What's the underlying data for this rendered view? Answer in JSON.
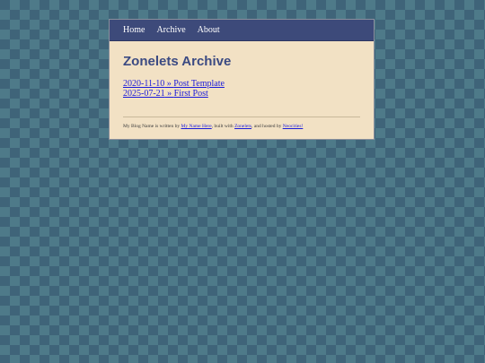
{
  "nav": {
    "home": "Home",
    "archive": "Archive",
    "about": "About"
  },
  "page_title": "Zonelets Archive",
  "posts": [
    {
      "date": "2020-11-10",
      "sep": " » ",
      "title": "Post Template"
    },
    {
      "date": "2025-07-21",
      "sep": " » ",
      "title": "First Post"
    }
  ],
  "footer": {
    "prefix": "My Blog Name is written by ",
    "author": "My Name Here",
    "mid1": ", built with ",
    "builder": "Zonelets",
    "mid2": ", and hosted by ",
    "host": "Neocities!"
  },
  "colors": {
    "background": "#3f6479",
    "card": "#f2e1c4",
    "nav": "#3d4a7a",
    "title": "#3b4a82",
    "link": "#1a1adb"
  }
}
